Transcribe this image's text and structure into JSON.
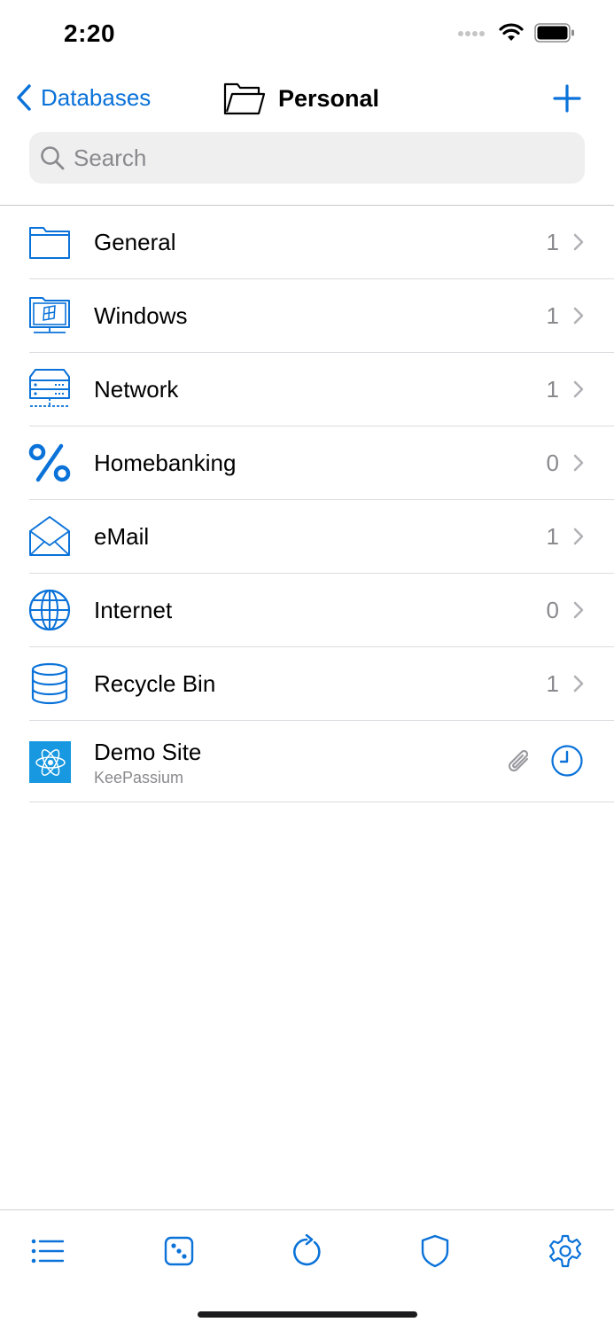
{
  "status_bar": {
    "time": "2:20"
  },
  "nav": {
    "back_label": "Databases",
    "title": "Personal"
  },
  "search": {
    "placeholder": "Search"
  },
  "groups": [
    {
      "label": "General",
      "count": "1",
      "icon": "folder-icon"
    },
    {
      "label": "Windows",
      "count": "1",
      "icon": "windows-computer-icon"
    },
    {
      "label": "Network",
      "count": "1",
      "icon": "network-server-icon"
    },
    {
      "label": "Homebanking",
      "count": "0",
      "icon": "percent-icon"
    },
    {
      "label": "eMail",
      "count": "1",
      "icon": "envelope-icon"
    },
    {
      "label": "Internet",
      "count": "0",
      "icon": "globe-icon"
    },
    {
      "label": "Recycle Bin",
      "count": "1",
      "icon": "database-icon"
    }
  ],
  "entry": {
    "title": "Demo Site",
    "subtitle": "KeePassium",
    "icon": "atom-icon",
    "indicators": [
      "paperclip-icon",
      "clock-icon"
    ]
  },
  "tab_bar": [
    "list-icon",
    "dice-icon",
    "refresh-icon",
    "shield-icon",
    "gear-icon"
  ],
  "colors": {
    "accent": "#0a72d9",
    "secondary_text": "#8a8a8e",
    "entry_icon_bg": "#1798e0"
  }
}
